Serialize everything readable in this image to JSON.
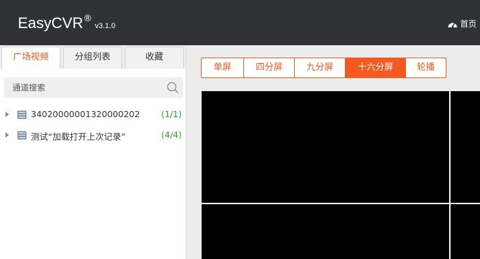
{
  "header": {
    "brand": "EasyCVR",
    "reg_mark": "®",
    "version": "v3.1.0",
    "home_label": "首页",
    "home_icon": "dashboard-icon"
  },
  "sidebar": {
    "tabs": [
      {
        "label": "广场视频",
        "active": true
      },
      {
        "label": "分组列表",
        "active": false
      },
      {
        "label": "收藏",
        "active": false
      }
    ],
    "search_placeholder": "通道搜索",
    "search_icon": "search-icon",
    "tree": [
      {
        "label": "34020000001320000202",
        "count": "(1/1)",
        "icon": "device-icon"
      },
      {
        "label": "测试“加载打开上次记录”",
        "count": "(4/4)",
        "icon": "device-icon"
      }
    ]
  },
  "split_options": [
    {
      "label": "单屏",
      "active": false
    },
    {
      "label": "四分屏",
      "active": false
    },
    {
      "label": "九分屏",
      "active": false
    },
    {
      "label": "十六分屏",
      "active": true
    },
    {
      "label": "轮播",
      "active": false
    }
  ],
  "colors": {
    "accent": "#f25a1f",
    "header_bg": "#2f3135",
    "count_green": "#2e9f2e"
  }
}
